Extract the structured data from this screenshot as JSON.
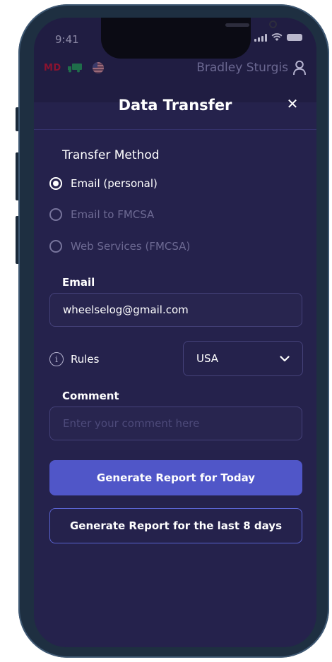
{
  "status_bar": {
    "time": "9:41"
  },
  "top_bar": {
    "state_code": "MD",
    "driver_name": "Bradley Sturgis"
  },
  "header": {
    "title": "Data Transfer",
    "close_glyph": "✕"
  },
  "transfer_method": {
    "label": "Transfer Method",
    "options": [
      {
        "label": "Email (personal)",
        "selected": true
      },
      {
        "label": "Email to FMCSA",
        "selected": false
      },
      {
        "label": "Web Services (FMCSA)",
        "selected": false
      }
    ]
  },
  "email": {
    "label": "Email",
    "value": "wheelselog@gmail.com"
  },
  "rules": {
    "label": "Rules",
    "selected": "USA"
  },
  "comment": {
    "label": "Comment",
    "placeholder": "Enter your comment here"
  },
  "buttons": {
    "today": "Generate Report for Today",
    "last_days": "Generate Report for the last 8 days"
  },
  "colors": {
    "background": "#25224c",
    "primary": "#5056c8",
    "accent_outline": "#5a63d0"
  },
  "icons": [
    "truck-icon",
    "us-flag-icon",
    "user-icon",
    "close-icon",
    "info-icon",
    "chevron-down-icon"
  ]
}
